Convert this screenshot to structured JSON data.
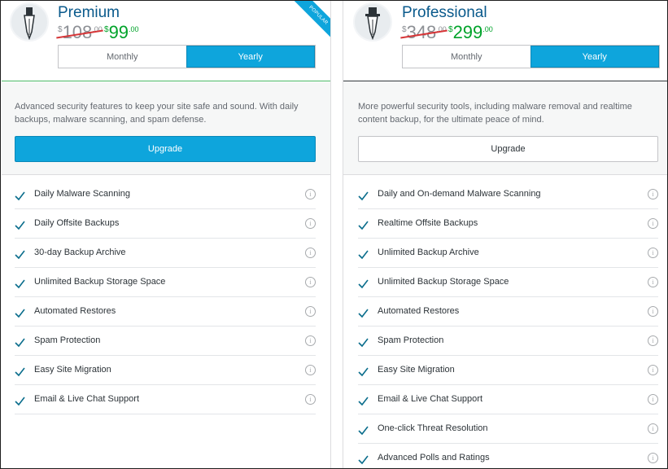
{
  "plans": [
    {
      "name": "Premium",
      "old_price": {
        "currency": "$",
        "amount": "108",
        "cents": ".00"
      },
      "new_price": {
        "currency": "$",
        "amount": "99",
        "cents": ".00"
      },
      "billing": {
        "monthly": "Monthly",
        "yearly": "Yearly",
        "selected": "Yearly"
      },
      "badge": "POPULAR",
      "description": "Advanced security features to keep your site safe and sound. With daily backups, malware scanning, and spam defense.",
      "cta": "Upgrade",
      "cta_style": "primary",
      "features": [
        "Daily Malware Scanning",
        "Daily Offsite Backups",
        "30-day Backup Archive",
        "Unlimited Backup Storage Space",
        "Automated Restores",
        "Spam Protection",
        "Easy Site Migration",
        "Email & Live Chat Support"
      ]
    },
    {
      "name": "Professional",
      "old_price": {
        "currency": "$",
        "amount": "348",
        "cents": ".00"
      },
      "new_price": {
        "currency": "$",
        "amount": "299",
        "cents": ".00"
      },
      "billing": {
        "monthly": "Monthly",
        "yearly": "Yearly",
        "selected": "Yearly"
      },
      "description": "More powerful security tools, including malware removal and realtime content backup, for the ultimate peace of mind.",
      "cta": "Upgrade",
      "cta_style": "secondary",
      "features": [
        "Daily and On-demand Malware Scanning",
        "Realtime Offsite Backups",
        "Unlimited Backup Archive",
        "Unlimited Backup Storage Space",
        "Automated Restores",
        "Spam Protection",
        "Easy Site Migration",
        "Email & Live Chat Support",
        "One-click Threat Resolution",
        "Advanced Polls and Ratings"
      ]
    }
  ],
  "colors": {
    "accent": "#0ea5dc",
    "plan_name": "#0a5a8c",
    "new_price": "#00a32a",
    "strike": "#d63638",
    "check": "#0a6d8c"
  },
  "icons": {
    "premium_logo": "fountain-pen-icon",
    "professional_logo": "top-hat-pen-icon",
    "feature_check": "checkmark-icon",
    "feature_info": "info-circle-icon"
  }
}
